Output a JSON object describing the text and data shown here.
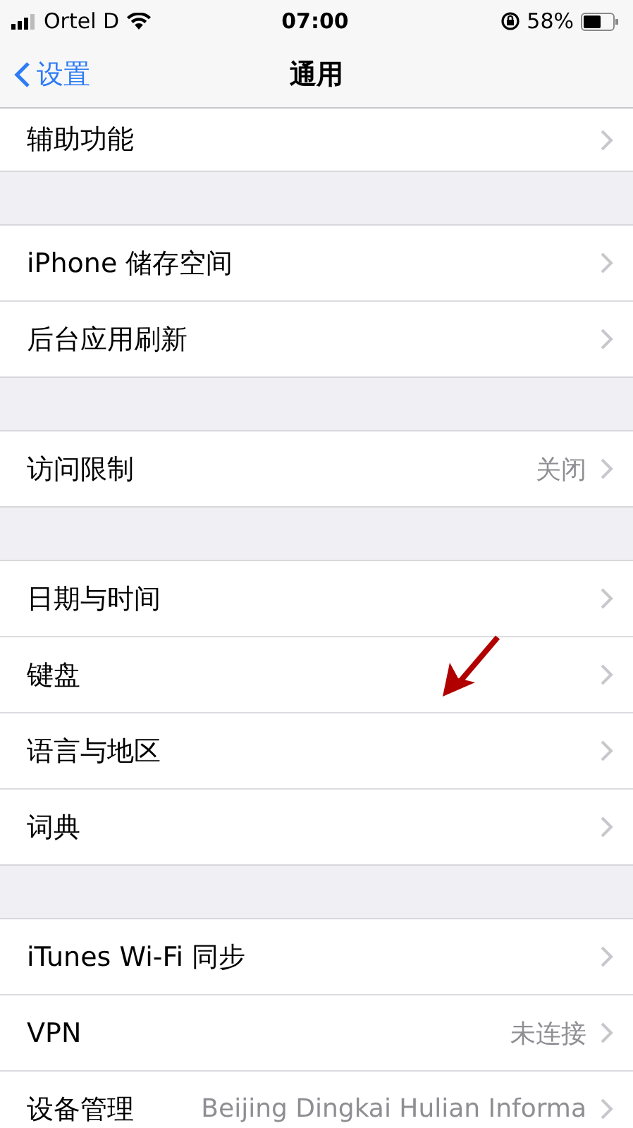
{
  "status_bar": {
    "carrier": "Ortel D",
    "time": "07:00",
    "battery": "58%"
  },
  "nav_bar": {
    "back": "设置",
    "title": "通用"
  },
  "groups": [
    {
      "rows": [
        {
          "label": "辅助功能"
        }
      ]
    },
    {
      "rows": [
        {
          "label": "iPhone 储存空间"
        },
        {
          "label": "后台应用刷新"
        }
      ]
    },
    {
      "rows": [
        {
          "label": "访问限制",
          "detail": "关闭"
        }
      ]
    },
    {
      "rows": [
        {
          "label": "日期与时间"
        },
        {
          "label": "键盘"
        },
        {
          "label": "语言与地区"
        },
        {
          "label": "词典"
        }
      ]
    },
    {
      "rows": [
        {
          "label": "iTunes Wi-Fi 同步"
        },
        {
          "label": "VPN",
          "detail": "未连接"
        },
        {
          "label": "设备管理",
          "detail": "Beijing Dingkai Hulian Informa"
        }
      ]
    }
  ]
}
